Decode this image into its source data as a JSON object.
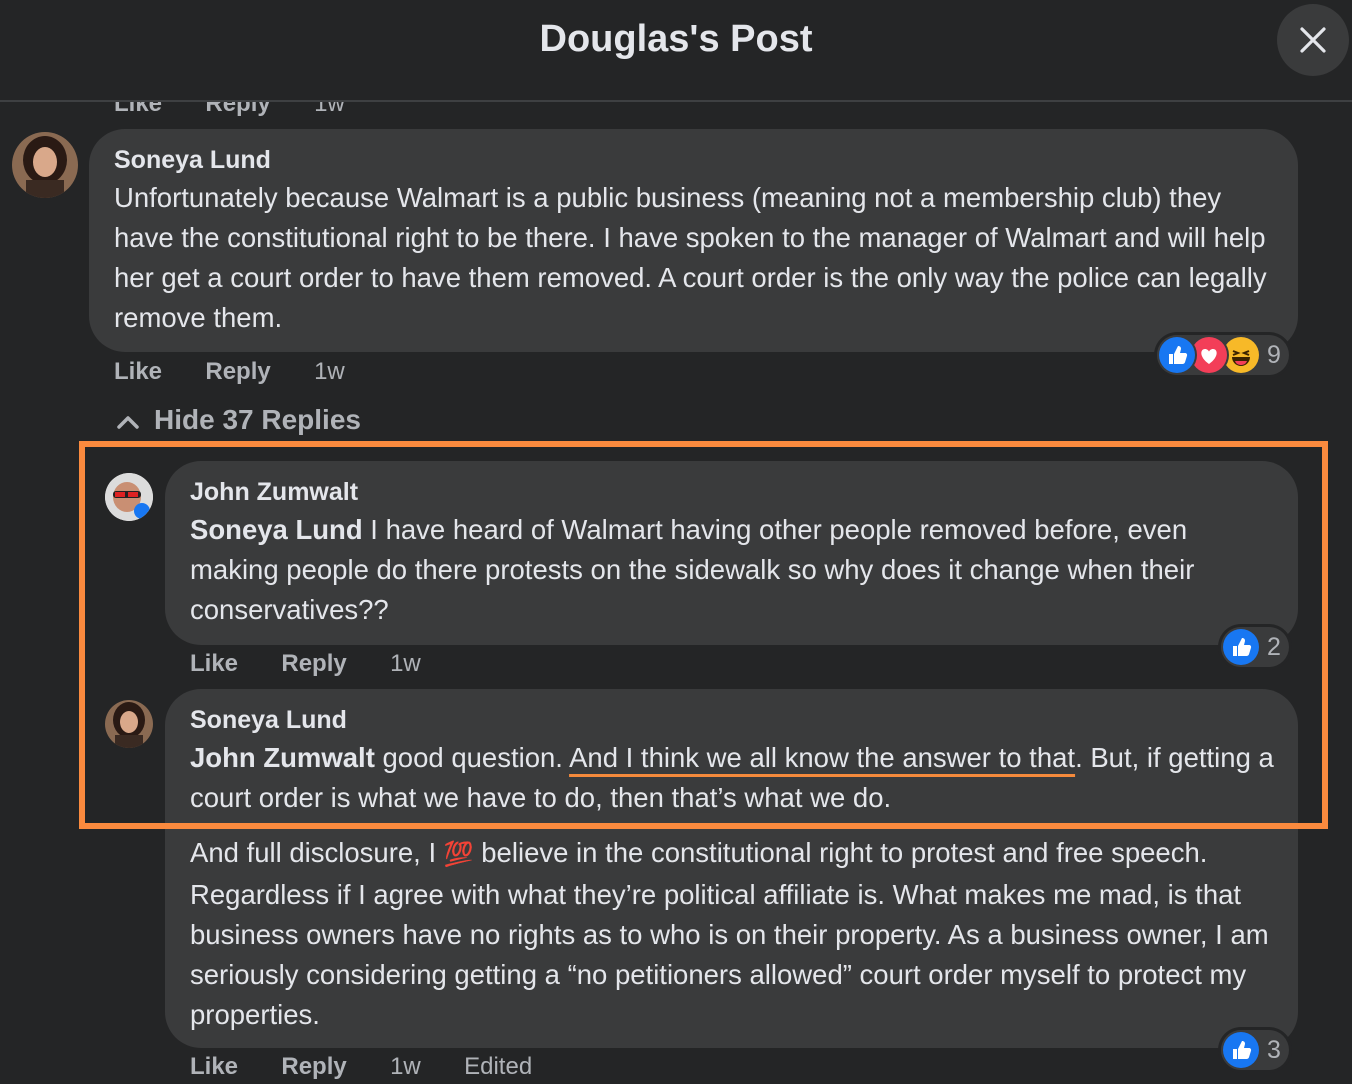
{
  "header": {
    "title": "Douglas's Post",
    "close_icon": "close-icon"
  },
  "top_partial_actions": {
    "like": "Like",
    "reply": "Reply",
    "time": "1w"
  },
  "comment_1": {
    "author": "Soneya Lund",
    "text": "Unfortunately because Walmart is a public business (meaning not a membership club) they have the constitutional right to be there. I have spoken to the manager of Walmart and will help her get a court order to have them removed. A court order is the only way the police can legally remove them.",
    "actions": {
      "like": "Like",
      "reply": "Reply",
      "time": "1w"
    },
    "reactions": {
      "icons": [
        "like-icon",
        "love-icon",
        "haha-icon"
      ],
      "count": "9"
    }
  },
  "replies_toggle": {
    "label": "Hide 37 Replies",
    "icon": "chevron-up-icon"
  },
  "reply_1": {
    "author": "John Zumwalt",
    "mention": "Soneya Lund",
    "text": " I have heard of Walmart having other people removed before, even making people do there protests on the sidewalk so why does it change when their conservatives??",
    "actions": {
      "like": "Like",
      "reply": "Reply",
      "time": "1w"
    },
    "reactions": {
      "icons": [
        "like-icon"
      ],
      "count": "2"
    }
  },
  "reply_2": {
    "author": "Soneya Lund",
    "mention": "John Zumwalt",
    "text_before": " good question. ",
    "text_underlined": "And I think we all know the answer to that",
    "text_after": ". But, if getting a court order is what we have to do, then that’s what we do.",
    "paragraph_2_before": "And full disclosure, I ",
    "emoji": "💯",
    "paragraph_2_after": " believe in the constitutional right to protest and free speech. Regardless if I agree with what they’re political affiliate is. What makes me mad, is that business owners have no rights as to who is on their property. As a business owner, I am seriously considering getting a “no petitioners allowed” court order myself to protect my properties.",
    "actions": {
      "like": "Like",
      "reply": "Reply",
      "time": "1w",
      "edited": "Edited"
    },
    "reactions": {
      "icons": [
        "like-icon"
      ],
      "count": "3"
    }
  },
  "colors": {
    "background": "#242526",
    "bubble": "#3a3b3c",
    "highlight": "#fa8a3e",
    "like_blue": "#1877f2",
    "love_red": "#f33e58",
    "haha_yellow": "#f7b928"
  }
}
